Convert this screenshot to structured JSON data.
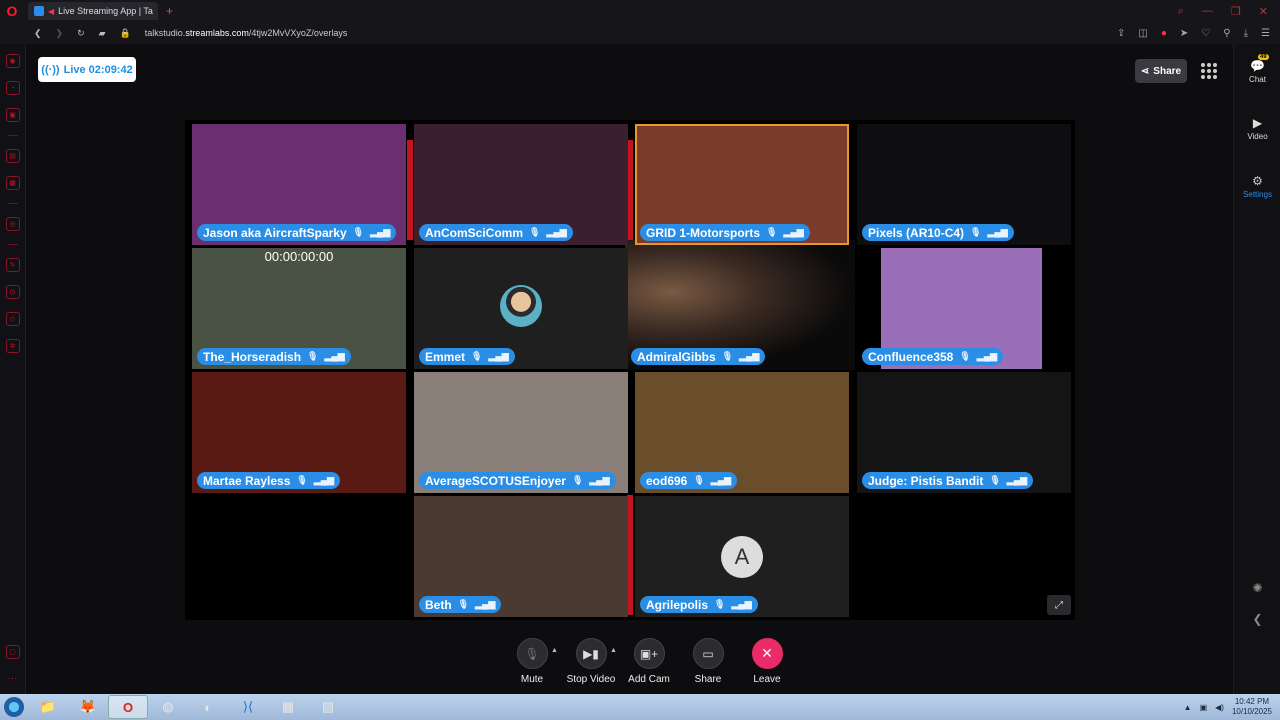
{
  "browser": {
    "tab_title": "Live Streaming App | Ta",
    "url_prefix": "talkstudio.",
    "url_domain": "streamlabs.com",
    "url_path": "/4tjw2MvVXyoZ/overlays"
  },
  "live": {
    "label": "Live 02:09:42"
  },
  "header": {
    "share_label": "Share"
  },
  "right_panel": {
    "chat_label": "Chat",
    "chat_badge": "49",
    "video_label": "Video",
    "settings_label": "Settings"
  },
  "tiles": [
    {
      "name": "Jason aka AircraftSparky",
      "bg": "#6a2f6e"
    },
    {
      "name": "AnComSciComm",
      "bg": "#3a1f2e"
    },
    {
      "name": "GRID 1-Motorsports",
      "bg": "#7b3a2a"
    },
    {
      "name": "Pixels (AR10-C4)",
      "bg": "#0e0e10"
    },
    {
      "name": "The_Horseradish",
      "bg": "#4a5244"
    },
    {
      "name": "Emmet",
      "bg": "#1f1f1f"
    },
    {
      "name": "AdmiralGibbs",
      "bg": "#2a1f1a"
    },
    {
      "name": "Confluence358",
      "bg": "#9a6fb8"
    },
    {
      "name": "Martae Rayless",
      "bg": "#5a1a14"
    },
    {
      "name": "AverageSCOTUSEnjoyer",
      "bg": "#8a7f78"
    },
    {
      "name": "eod696",
      "bg": "#6a4e2c"
    },
    {
      "name": "Judge: Pistis Bandit",
      "bg": "#141414"
    },
    {
      "name": "Beth",
      "bg": "#4a3a32"
    },
    {
      "name": "Agrilepolis",
      "bg": "#1f1f1f"
    }
  ],
  "timer": "00:00:00:00",
  "avatar_letter": "A",
  "controls": {
    "mute": "Mute",
    "stop_video": "Stop Video",
    "add_cam": "Add Cam",
    "share": "Share",
    "leave": "Leave"
  },
  "taskbar": {
    "time": "10:42 PM",
    "date": "10/10/2025"
  }
}
